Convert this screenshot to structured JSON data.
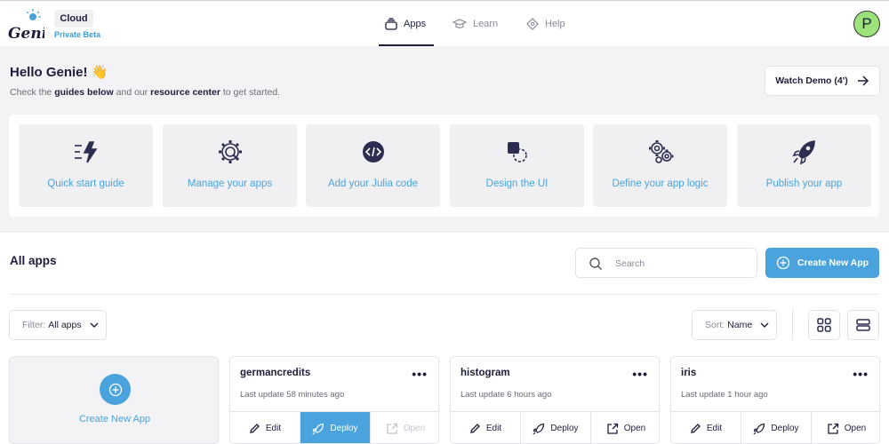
{
  "header": {
    "logo_text": "Genie",
    "product": "Cloud",
    "badge": "Private Beta",
    "tabs": [
      {
        "label": "Apps",
        "icon": "stack-icon",
        "active": true
      },
      {
        "label": "Learn",
        "icon": "graduation-cap-icon",
        "active": false
      },
      {
        "label": "Help",
        "icon": "diamond-question-icon",
        "active": false
      }
    ],
    "avatar_letter": "P",
    "avatar_color": "#9be37a"
  },
  "intro": {
    "greeting": "Hello Genie! 👋",
    "text_before": "Check the ",
    "link_guides": "guides below",
    "text_middle": " and our ",
    "link_resource": "resource center",
    "text_after": " to get started.",
    "demo_button": "Watch Demo (4')"
  },
  "guides": [
    {
      "label": "Quick start guide",
      "icon": "lightning-icon"
    },
    {
      "label": "Manage your apps",
      "icon": "gear-search-icon"
    },
    {
      "label": "Add your Julia code",
      "icon": "code-icon"
    },
    {
      "label": "Design the UI",
      "icon": "shapes-icon"
    },
    {
      "label": "Define your app logic",
      "icon": "gears-icon"
    },
    {
      "label": "Publish your app",
      "icon": "rocket-icon"
    }
  ],
  "apps_section": {
    "title": "All apps",
    "search_placeholder": "Search",
    "create_button": "Create New App",
    "filter_label": "Filter:",
    "filter_value": "All apps",
    "sort_label": "Sort:",
    "sort_value": "Name"
  },
  "new_app_card": {
    "label": "Create New App"
  },
  "apps": [
    {
      "name": "germancredits",
      "updated": "Last update 58 minutes ago",
      "edit": "Edit",
      "deploy": "Deploy",
      "open": "Open",
      "deploy_primary": true,
      "open_disabled": true
    },
    {
      "name": "histogram",
      "updated": "Last update 6 hours ago",
      "edit": "Edit",
      "deploy": "Deploy",
      "open": "Open",
      "deploy_primary": false,
      "open_disabled": false
    },
    {
      "name": "iris",
      "updated": "Last update 1 hour ago",
      "edit": "Edit",
      "deploy": "Deploy",
      "open": "Open",
      "deploy_primary": false,
      "open_disabled": false
    }
  ],
  "colors": {
    "accent": "#4aa3dc",
    "dark": "#1d1d3b",
    "muted": "#8a8a99"
  }
}
